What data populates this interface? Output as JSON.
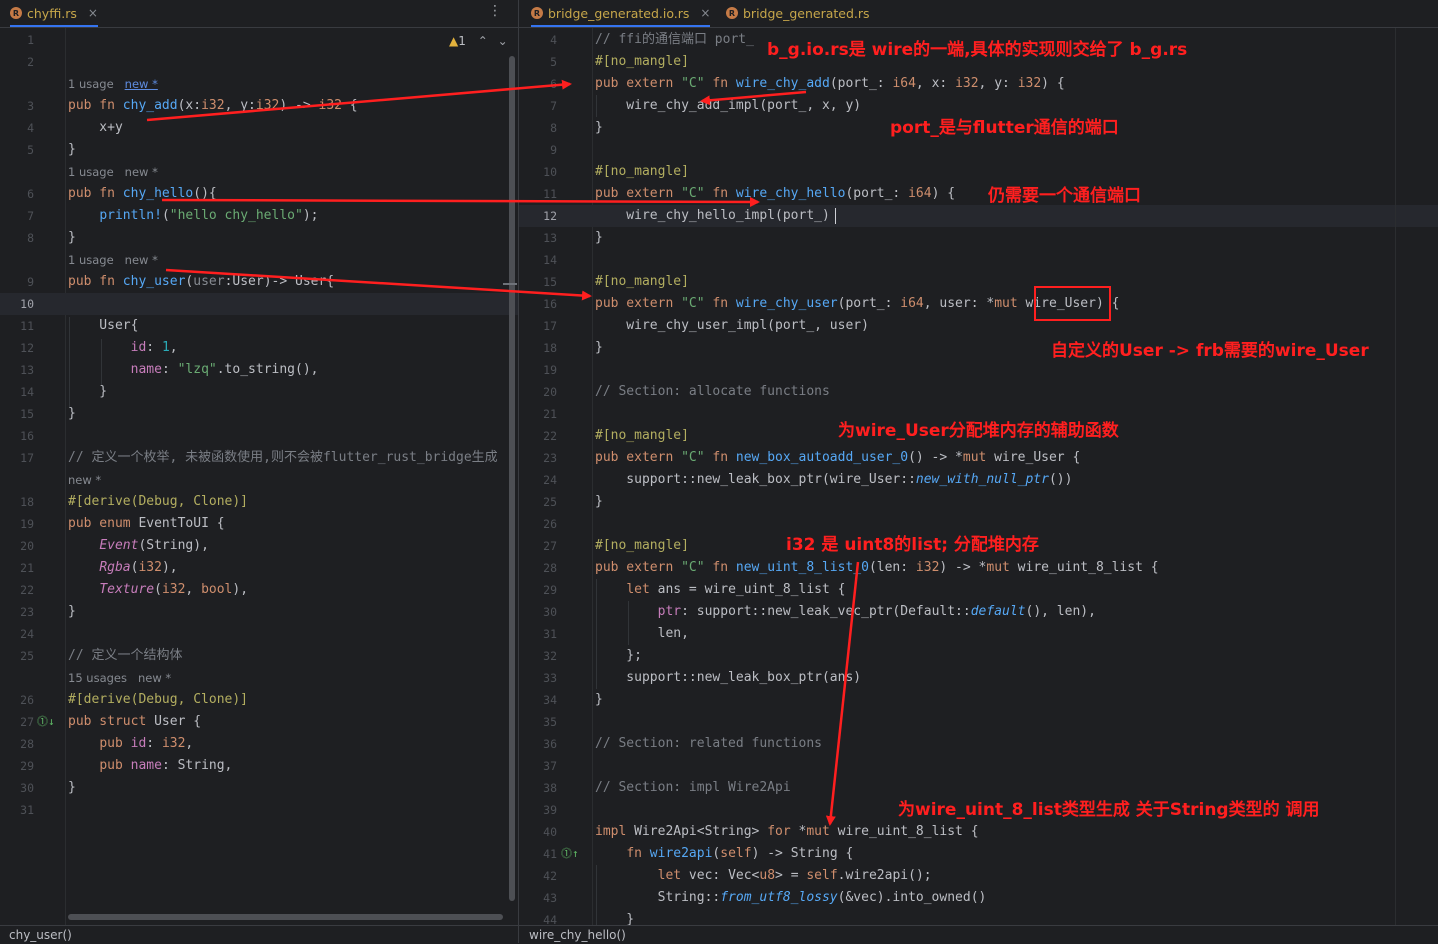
{
  "left": {
    "tab": {
      "label": "chyffi.rs",
      "close": "×"
    },
    "menu_glyph": "⋮",
    "warning_count": "1",
    "status": "chy_user()",
    "hints": {
      "h1_usage": "1 usage",
      "h1_new": "new *",
      "h2_usage": "1 usage",
      "h2_new": "new *",
      "h3_usage": "1 usage",
      "h3_new": "new *",
      "h4_new": "new *",
      "h5_usage": "15 usages",
      "h5_new": "new *"
    }
  },
  "right": {
    "tab1": {
      "label": "bridge_generated.io.rs",
      "close": "×"
    },
    "tab2": {
      "label": "bridge_generated.rs"
    },
    "status": "wire_chy_hello()"
  },
  "annotations": {
    "a1": "b_g.io.rs是 wire的一端,具体的实现则交给了 b_g.rs",
    "a2": "port_是与flutter通信的端口",
    "a3": "仍需要一个通信端口",
    "a4": "自定义的User ->  frb需要的wire_User",
    "a5": "为wire_User分配堆内存的辅助函数",
    "a6": "i32 是 uint8的list;  分配堆内存",
    "a7": "为wire_uint_8_list类型生成 关于String类型的  调用"
  },
  "colors": {
    "annotation": "#ff1f1f",
    "accent": "#3574f0",
    "background": "#1e1f22"
  }
}
